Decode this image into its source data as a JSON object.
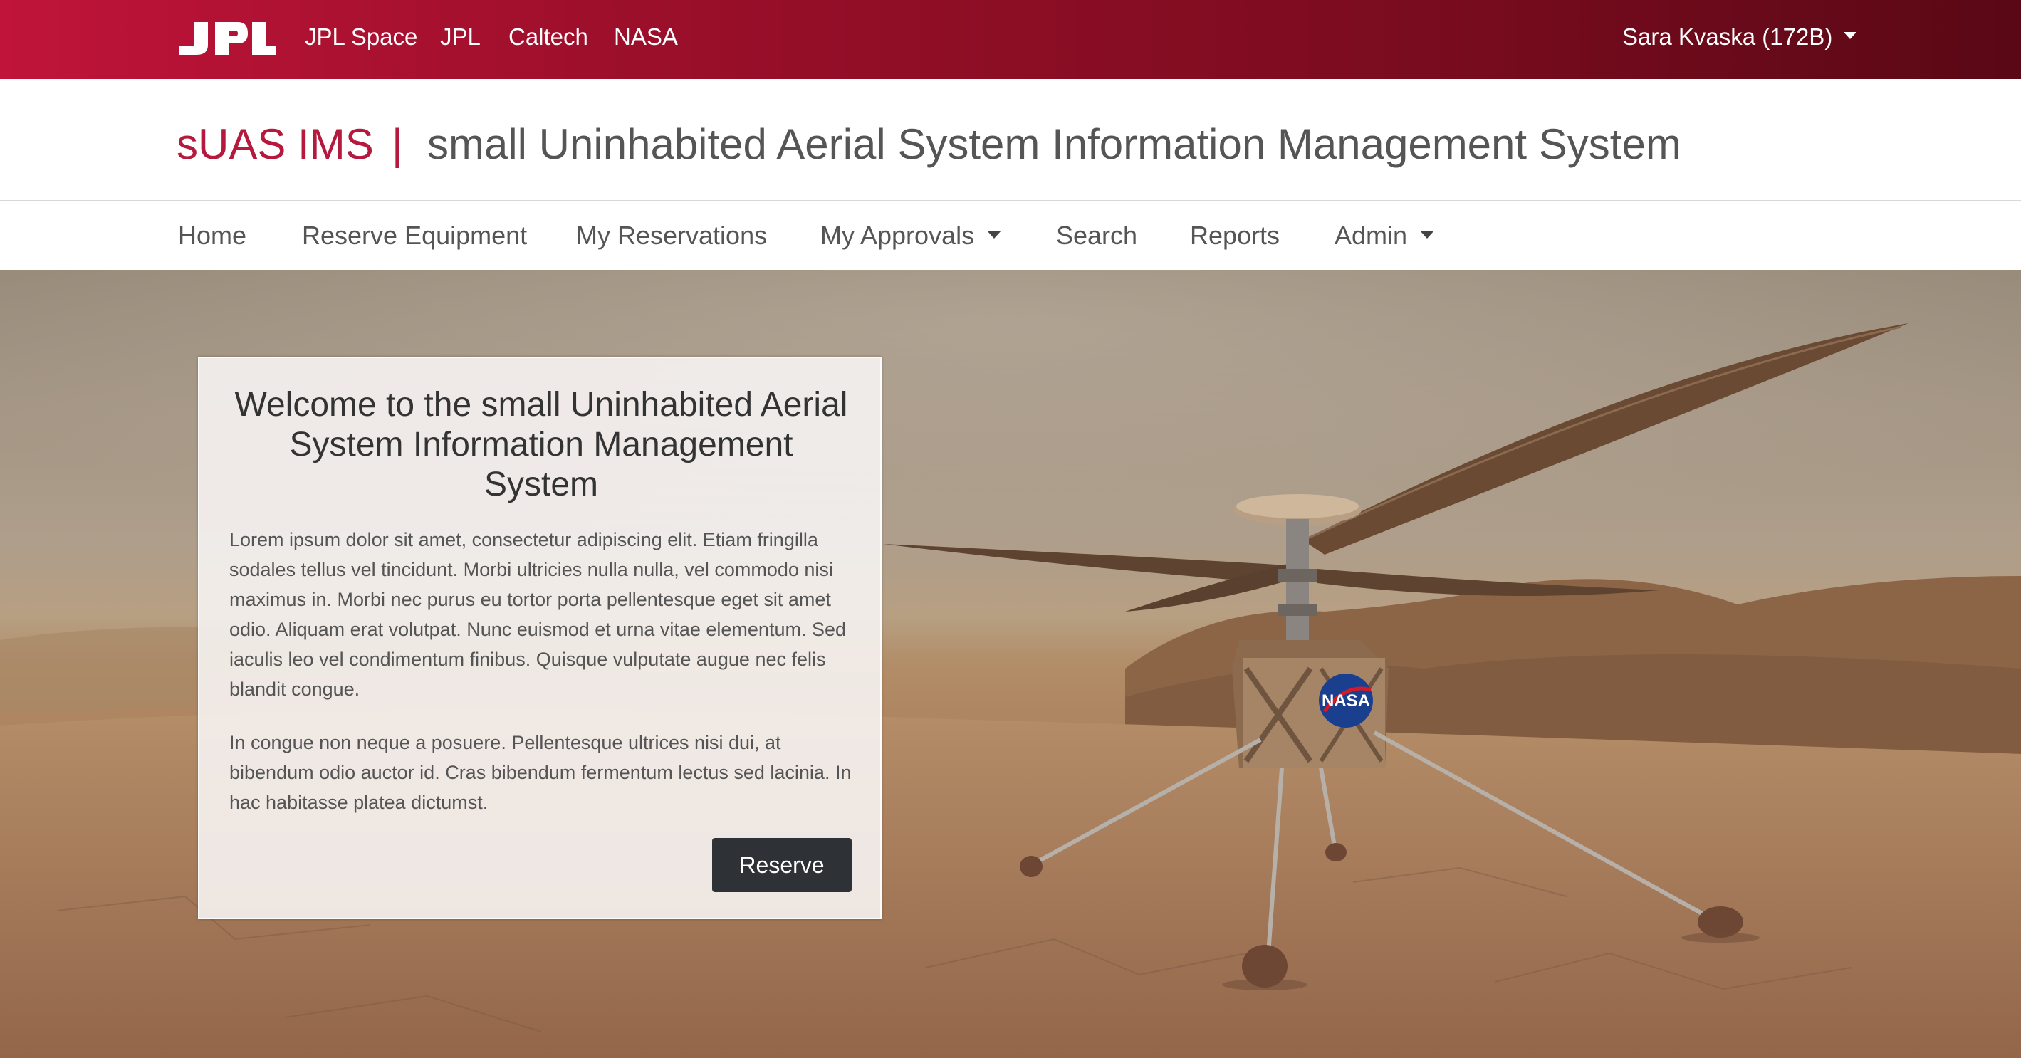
{
  "topbar": {
    "logo": "JPL",
    "links": [
      "JPL Space",
      "JPL",
      "Caltech",
      "NASA"
    ],
    "user": "Sara Kvaska (172B)"
  },
  "header": {
    "short_name": "sUAS IMS",
    "separator": "|",
    "full_name": "small Uninhabited Aerial System Information Management System"
  },
  "nav": {
    "home": "Home",
    "reserve_equipment": "Reserve Equipment",
    "my_reservations": "My Reservations",
    "my_approvals": "My Approvals",
    "search": "Search",
    "reports": "Reports",
    "admin": "Admin"
  },
  "hero": {
    "badge_text": "NASA"
  },
  "welcome": {
    "title": "Welcome to the small Uninhabited Aerial System Information Management System",
    "paragraph1": "Lorem ipsum dolor sit amet, consectetur adipiscing elit. Etiam fringilla sodales tellus vel tincidunt. Morbi ultricies nulla nulla, vel commodo nisi maximus in. Morbi nec purus eu tortor porta pellentesque eget sit amet odio. Aliquam erat volutpat. Nunc euismod et urna vitae elementum. Sed iaculis leo vel condimentum finibus. Quisque vulputate augue nec felis blandit congue.",
    "paragraph2": "In congue non neque a posuere. Pellentesque ultrices nisi dui, at bibendum odio auctor id. Cras bibendum fermentum lectus sed lacinia. In hac habitasse platea dictumst.",
    "button": "Reserve"
  },
  "colors": {
    "brand_red": "#b5193d",
    "topbar_start": "#c0143a",
    "topbar_end": "#5a0815",
    "button_dark": "#2e3236"
  },
  "icons": {
    "logo": "jpl-logo",
    "dropdown": "caret-down-icon"
  }
}
